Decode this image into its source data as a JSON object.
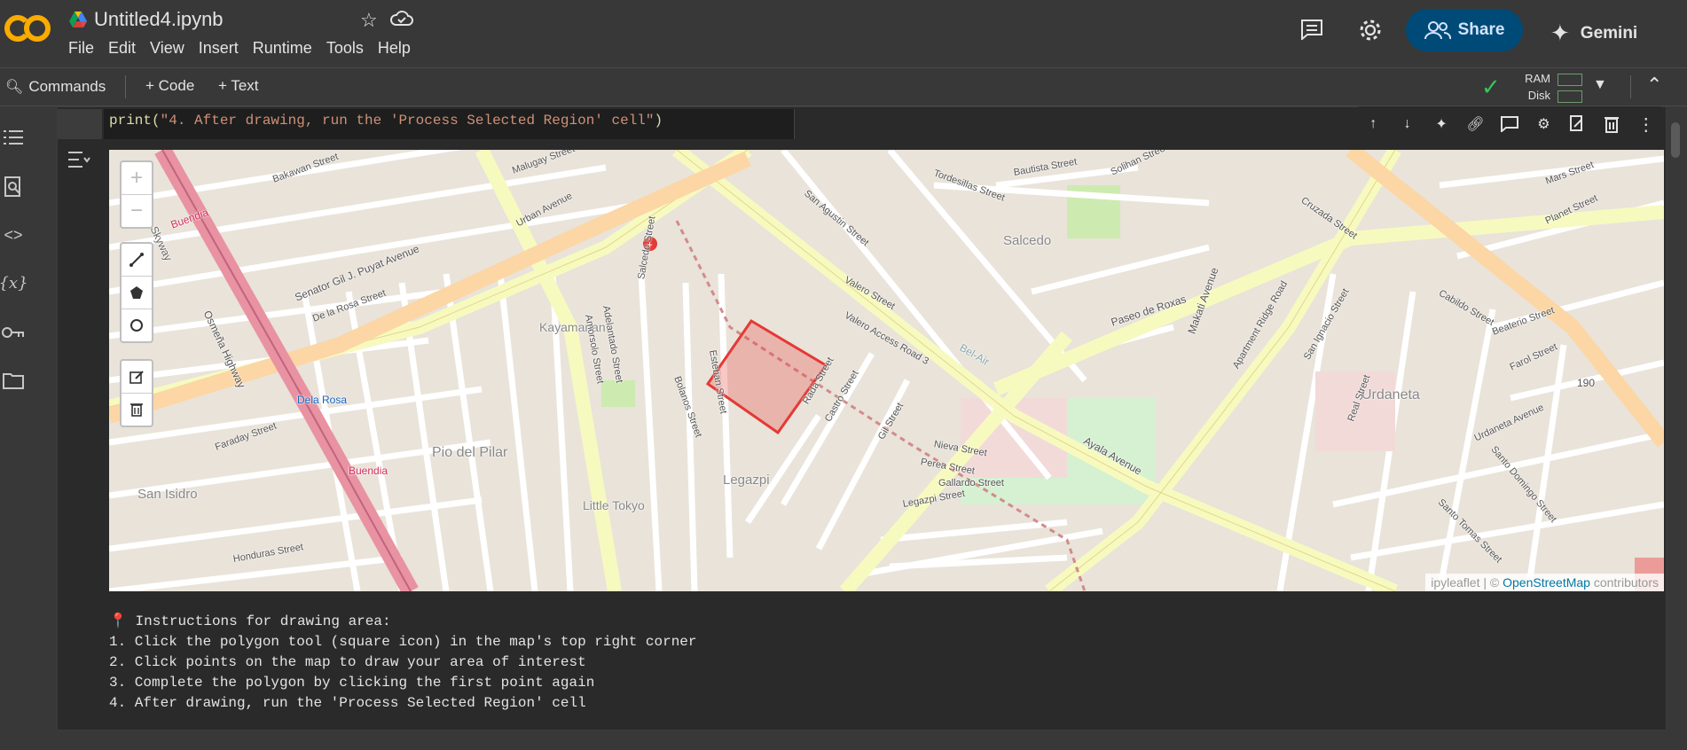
{
  "app": {
    "logo_text": "CO",
    "notebook_title": "Untitled4.ipynb"
  },
  "menu": [
    "File",
    "Edit",
    "View",
    "Insert",
    "Runtime",
    "Tools",
    "Help"
  ],
  "top_actions": {
    "share_label": "Share",
    "gemini_label": "Gemini"
  },
  "toolbar": {
    "commands_label": "Commands",
    "add_code_label": "+ Code",
    "add_text_label": "+ Text",
    "ram_label": "RAM",
    "disk_label": "Disk"
  },
  "code": {
    "line_prefix": "print(",
    "line_string": "\"4. After drawing, run the 'Process Selected Region' cell\"",
    "line_suffix": ")"
  },
  "map": {
    "labels": [
      {
        "text": "Skyway"
      },
      {
        "text": "Buendia"
      },
      {
        "text": "Bakawan Street"
      },
      {
        "text": "Malugay Street"
      },
      {
        "text": "Urban Avenue"
      },
      {
        "text": "Senator Gil J. Puyat Avenue"
      },
      {
        "text": "Osmeña Highway"
      },
      {
        "text": "De la Rosa Street"
      },
      {
        "text": "Kayamanan"
      },
      {
        "text": "Salcedo"
      },
      {
        "text": "Paseo de Roxas"
      },
      {
        "text": "Makati Avenue"
      },
      {
        "text": "Ayala Avenue"
      },
      {
        "text": "Urdaneta"
      },
      {
        "text": "Legazpi"
      },
      {
        "text": "Pio del Pilar"
      },
      {
        "text": "San Isidro"
      },
      {
        "text": "Little Tokyo"
      },
      {
        "text": "Dela Rosa"
      },
      {
        "text": "Bel-Air"
      },
      {
        "text": "Valero Street"
      },
      {
        "text": "San Agustin Street"
      },
      {
        "text": "Tordesillas Street"
      },
      {
        "text": "Bautista Street"
      },
      {
        "text": "Solihan Street"
      },
      {
        "text": "Cruzada Street"
      },
      {
        "text": "Mars Street"
      },
      {
        "text": "Planet Street"
      },
      {
        "text": "Cabildo Street"
      },
      {
        "text": "Faraday Street"
      },
      {
        "text": "Honduras Street"
      },
      {
        "text": "Nieva Street"
      },
      {
        "text": "Perea Street"
      },
      {
        "text": "Gallardo Street"
      },
      {
        "text": "Legazpi Street"
      },
      {
        "text": "Rada Street"
      },
      {
        "text": "Castro Street"
      },
      {
        "text": "Gil Street"
      },
      {
        "text": "Real Street"
      },
      {
        "text": "Santo Domingo Street"
      },
      {
        "text": "Santo Tomas Street"
      },
      {
        "text": "Urdaneta Avenue"
      },
      {
        "text": "Apartment Ridge Road"
      },
      {
        "text": "San Ignacio Street"
      },
      {
        "text": "Beaterio Street"
      },
      {
        "text": "Farol Street"
      },
      {
        "text": "Amorsolo Street"
      },
      {
        "text": "Adelantado Street"
      },
      {
        "text": "Salcedo Street"
      },
      {
        "text": "Esteban Street"
      },
      {
        "text": "Bolanos Street"
      },
      {
        "text": "Valero Access Road 3"
      },
      {
        "text": "Buendia"
      },
      {
        "text": "190"
      }
    ],
    "attribution_prefix": "ipyleaflet | © ",
    "attribution_link": "OpenStreetMap",
    "attribution_suffix": " contributors",
    "polygon_color": "#e53935"
  },
  "output": {
    "pin_icon": "📍",
    "heading": " Instructions for drawing area:",
    "lines": [
      "1. Click the polygon tool (square icon) in the map's top right corner",
      "2. Click points on the map to draw your area of interest",
      "3. Complete the polygon by clicking the first point again",
      "4. After drawing, run the 'Process Selected Region' cell"
    ]
  },
  "colors": {
    "share_bg": "#004a77",
    "share_text": "#d3e3fd",
    "check": "#36c55a",
    "code_string": "#ce9178",
    "code_keyword": "#dcdcaa"
  }
}
